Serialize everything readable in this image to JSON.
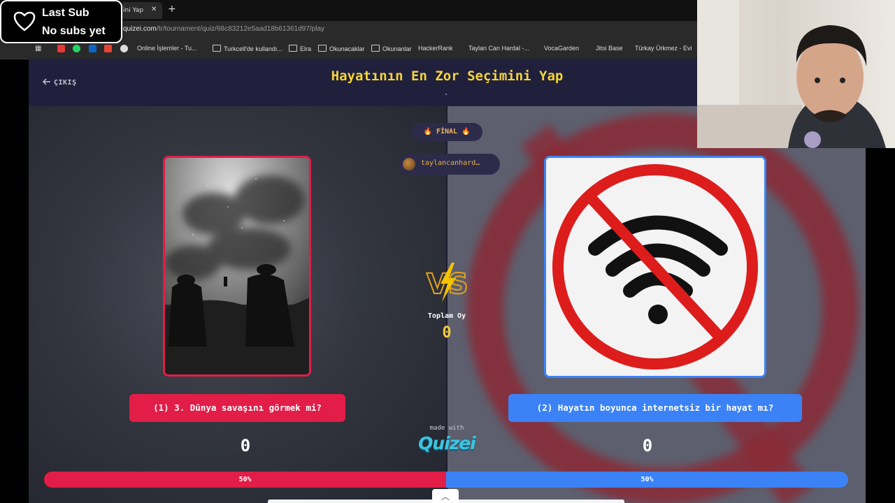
{
  "browser": {
    "tab_title": "ini Yap",
    "url_host": "quizei.com",
    "url_path": "/tr/tournament/quiz/68c83212e5aad18b61361d97/play",
    "bookmarks": [
      "Online İşlemler - Tu...",
      "Turkcell'de kullandı...",
      "Elra",
      "Okunacaklar",
      "Okunanlar",
      "HackerRank",
      "Taylan Can Hardal -...",
      "VocaGarden",
      "Jitsi Base",
      "Türkay Ürkmez - Evi"
    ]
  },
  "header": {
    "exit_label": "ÇIKIŞ",
    "title": "Hayatının En Zor Seçimini Yap"
  },
  "round": {
    "badge": "🔥 FİNAL 🔥",
    "username": "taylancanhard…"
  },
  "center": {
    "total_label": "Toplam Oy",
    "total_count": "0",
    "made_with": "made with",
    "logo_text": "QUIZEI"
  },
  "options": {
    "left": {
      "label": "(1) 3. Dünya savaşını görmek mi?",
      "count": "0",
      "percent_label": "50%",
      "share": 0.5,
      "color": "#e11d48"
    },
    "right": {
      "label": "(2) Hayatın boyunca internetsiz bir hayat mı?",
      "count": "0",
      "percent_label": "50%",
      "share": 0.5,
      "color": "#3b82f6"
    }
  },
  "overlay": {
    "sub_line1": "Last Sub",
    "sub_line2": "No subs yet"
  },
  "icons": [
    "heart-icon",
    "arrow-left-icon",
    "fire-icon",
    "vs-lightning-icon",
    "chevron-up-icon",
    "no-wifi-icon"
  ]
}
